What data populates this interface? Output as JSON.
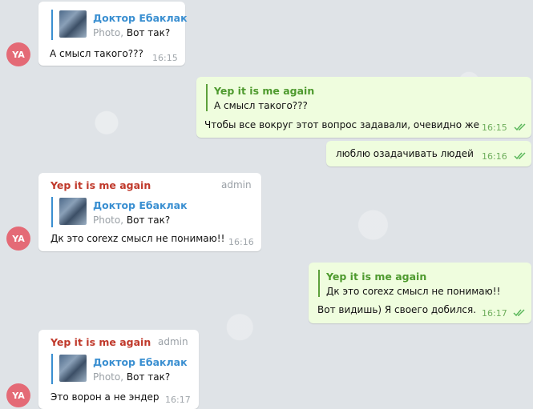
{
  "avatar_initials": "YA",
  "photo_label": "Photo,",
  "colors": {
    "accent_reply": "#3a8fd1",
    "sender_name": "#c0392b",
    "outgoing_bg": "#effdde",
    "check": "#5cb85c"
  },
  "messages": [
    {
      "reply_name": "Доктор Ебаклак",
      "reply_text": "Вот так?",
      "text": "А смысл такого???",
      "time": "16:15"
    },
    {
      "reply_name": "Yep it is me again",
      "reply_text": "А смысл такого???",
      "text": "Чтобы все вокруг этот вопрос задавали, очевидно же",
      "time": "16:15"
    },
    {
      "text": "люблю озадачивать людей",
      "time": "16:16"
    },
    {
      "sender": "Yep it is me again",
      "badge": "admin",
      "reply_name": "Доктор Ебаклак",
      "reply_text": "Вот так?",
      "text": "Дк это corexz смысл не понимаю!!",
      "time": "16:16"
    },
    {
      "reply_name": "Yep it is me again",
      "reply_text": "Дк это corexz смысл не понимаю!!",
      "text": "Вот видишь) Я своего добился.",
      "time": "16:17"
    },
    {
      "sender": "Yep it is me again",
      "badge": "admin",
      "reply_name": "Доктор Ебаклак",
      "reply_text": "Вот так?",
      "text": "Это ворон а не эндер",
      "time": "16:17"
    }
  ]
}
